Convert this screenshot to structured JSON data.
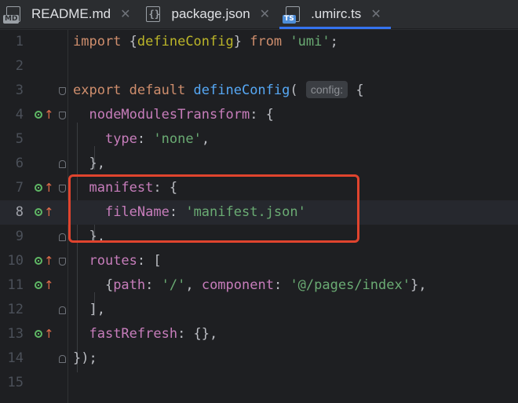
{
  "tabs": [
    {
      "label": "README.md",
      "icon": "markdown-file-icon",
      "badge": "MD",
      "active": false
    },
    {
      "label": "package.json",
      "icon": "json-file-icon",
      "badge": "",
      "active": false
    },
    {
      "label": ".umirc.ts",
      "icon": "typescript-file-icon",
      "badge": "TS",
      "active": true
    }
  ],
  "close_glyph": "✕",
  "editor": {
    "line_numbers": [
      "1",
      "2",
      "3",
      "4",
      "5",
      "6",
      "7",
      "8",
      "9",
      "10",
      "11",
      "12",
      "13",
      "14",
      "15"
    ],
    "current_line": 8,
    "inlay_hint": "config:",
    "gutter_arrow": "↑",
    "highlight_color": "#e0442e"
  }
}
